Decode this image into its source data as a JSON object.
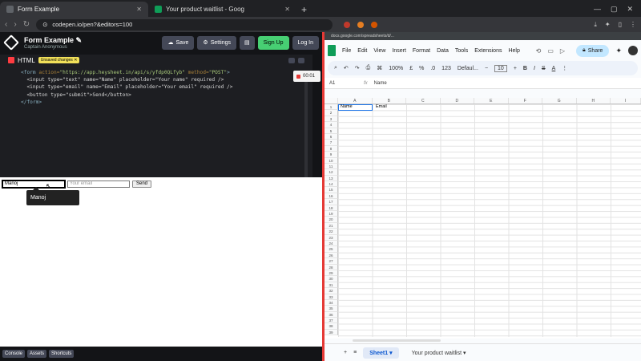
{
  "browser": {
    "tabs": [
      {
        "title": "Form Example",
        "active": true,
        "fav_color": "#5f6368"
      },
      {
        "title": "Your product waitlist - Goog",
        "active": false,
        "fav_color": "#0f9d58"
      }
    ],
    "url": "codepen.io/pen?&editors=100"
  },
  "codepen": {
    "title": "Form Example",
    "author": "Captain Anonymous",
    "buttons": {
      "save": "Save",
      "settings": "Settings",
      "signup": "Sign Up",
      "login": "Log In"
    },
    "editor": {
      "lang": "HTML",
      "badge": "Unsaved changes",
      "code": {
        "l1_open": "<form",
        "l1_attr1": " action=",
        "l1_val1": "\"https://app.heysheet.in/api/s/yfdp0QLfyb\"",
        "l1_attr2": " method=",
        "l1_val2": "\"POST\"",
        "l1_close": ">",
        "l2": "  <input type=\"text\" name=\"Name\" placeholder=\"Your name\" required />",
        "l3": "  <input type=\"email\" name=\"Email\" placeholder=\"Your email\" required />",
        "l4": "  <button type=\"submit\">Send</button>",
        "l5": "</form>"
      }
    },
    "recording": "00:01",
    "preview": {
      "name_value": "Manoj",
      "email_placeholder": "Your email",
      "send": "Send",
      "tooltip": "Manoj"
    },
    "footer": [
      "Console",
      "Assets",
      "Shortcuts"
    ]
  },
  "sheets": {
    "url": "docs.google.com/spreadsheets/d/...",
    "menu": [
      "File",
      "Edit",
      "View",
      "Insert",
      "Format",
      "Data",
      "Tools",
      "Extensions",
      "Help"
    ],
    "share": "Share",
    "toolbar": {
      "zoom": "100%",
      "font": "Defaul...",
      "size": "10",
      "currency": "£",
      "percent": "%",
      "decimals": "123"
    },
    "name_box": "A1",
    "formula": "Name",
    "columns": [
      "A",
      "B",
      "C",
      "D",
      "E",
      "F",
      "G",
      "H",
      "I"
    ],
    "rows": [
      "1",
      "2",
      "3",
      "4",
      "5",
      "6",
      "7",
      "8",
      "9",
      "10",
      "11",
      "12",
      "13",
      "14",
      "15",
      "16",
      "17",
      "18",
      "19",
      "20",
      "21",
      "22",
      "23",
      "24",
      "25",
      "26",
      "27",
      "28",
      "29",
      "30",
      "31",
      "32",
      "33",
      "34",
      "35",
      "36",
      "37",
      "38",
      "39"
    ],
    "cells": {
      "A1": "Name",
      "B1": "Email"
    },
    "sheet_tabs": [
      "Sheet1",
      "Your product waitlist"
    ]
  },
  "colors": {
    "accent_green": "#47cf73",
    "divider": "#e53935",
    "selection": "#1a73e8"
  }
}
